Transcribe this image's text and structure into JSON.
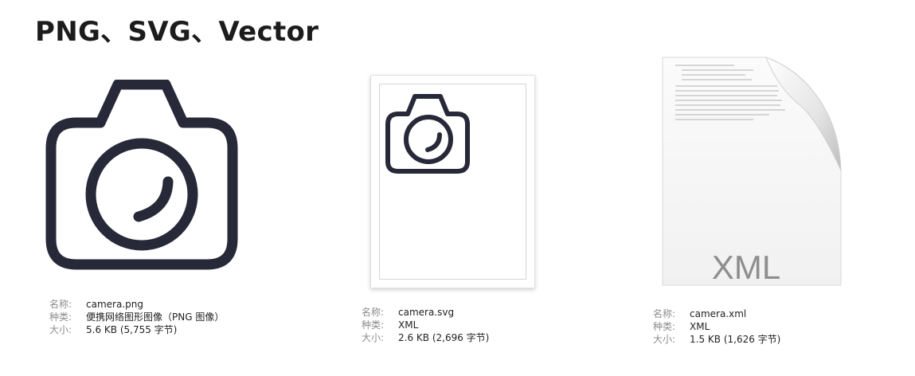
{
  "title": "PNG、SVG、Vector",
  "labels": {
    "name": "名称:",
    "kind": "种类:",
    "size": "大小:"
  },
  "files": [
    {
      "name": "camera.png",
      "kind": "便携网络图形图像（PNG 图像）",
      "size": "5.6 KB (5,755 字节)"
    },
    {
      "name": "camera.svg",
      "kind": "XML",
      "size": "2.6 KB (2,696 字节)"
    },
    {
      "name": "camera.xml",
      "kind": "XML",
      "size": "1.5 KB (1,626 字节)",
      "preview_text": "XML"
    }
  ],
  "colors": {
    "icon": "#272838",
    "meta_key": "#8c8c8c"
  }
}
